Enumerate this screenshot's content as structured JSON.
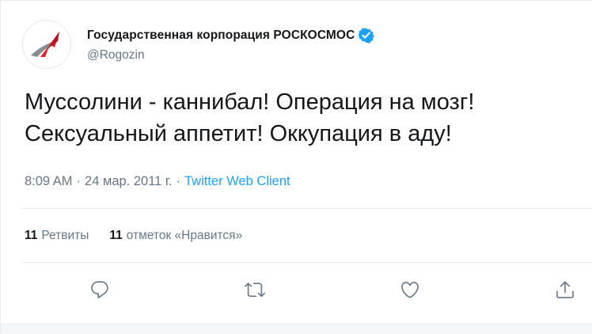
{
  "tweet": {
    "author": {
      "display_name": "Государственная корпорация РОСКОСМОС",
      "handle": "@Rogozin",
      "avatar_icon": "roscosmos-logo-icon",
      "verified_icon": "verified-badge-icon",
      "verified_color": "#1da1f2"
    },
    "text_lines": [
      "Муссолини - каннибал! Операция на мозг!",
      "Сексуальный аппетит! Оккупация в аду!"
    ],
    "meta": {
      "time": "8:09 AM",
      "separator": "·",
      "date": "24 мар. 2011 г.",
      "source": "Twitter Web Client"
    },
    "stats": {
      "retweets_count": "11",
      "retweets_label": "Ретвиты",
      "likes_count": "11",
      "likes_label": "отметок «Нравится»"
    },
    "actions": [
      {
        "name": "reply",
        "icon": "reply-icon"
      },
      {
        "name": "retweet",
        "icon": "retweet-icon"
      },
      {
        "name": "like",
        "icon": "heart-icon"
      },
      {
        "name": "share",
        "icon": "share-icon"
      }
    ]
  },
  "colors": {
    "text_primary": "#14171a",
    "text_secondary": "#657786",
    "link": "#1da1f2",
    "divider": "#e6ecf0",
    "logo_red": "#e31e24",
    "logo_gray": "#8a8d91"
  }
}
